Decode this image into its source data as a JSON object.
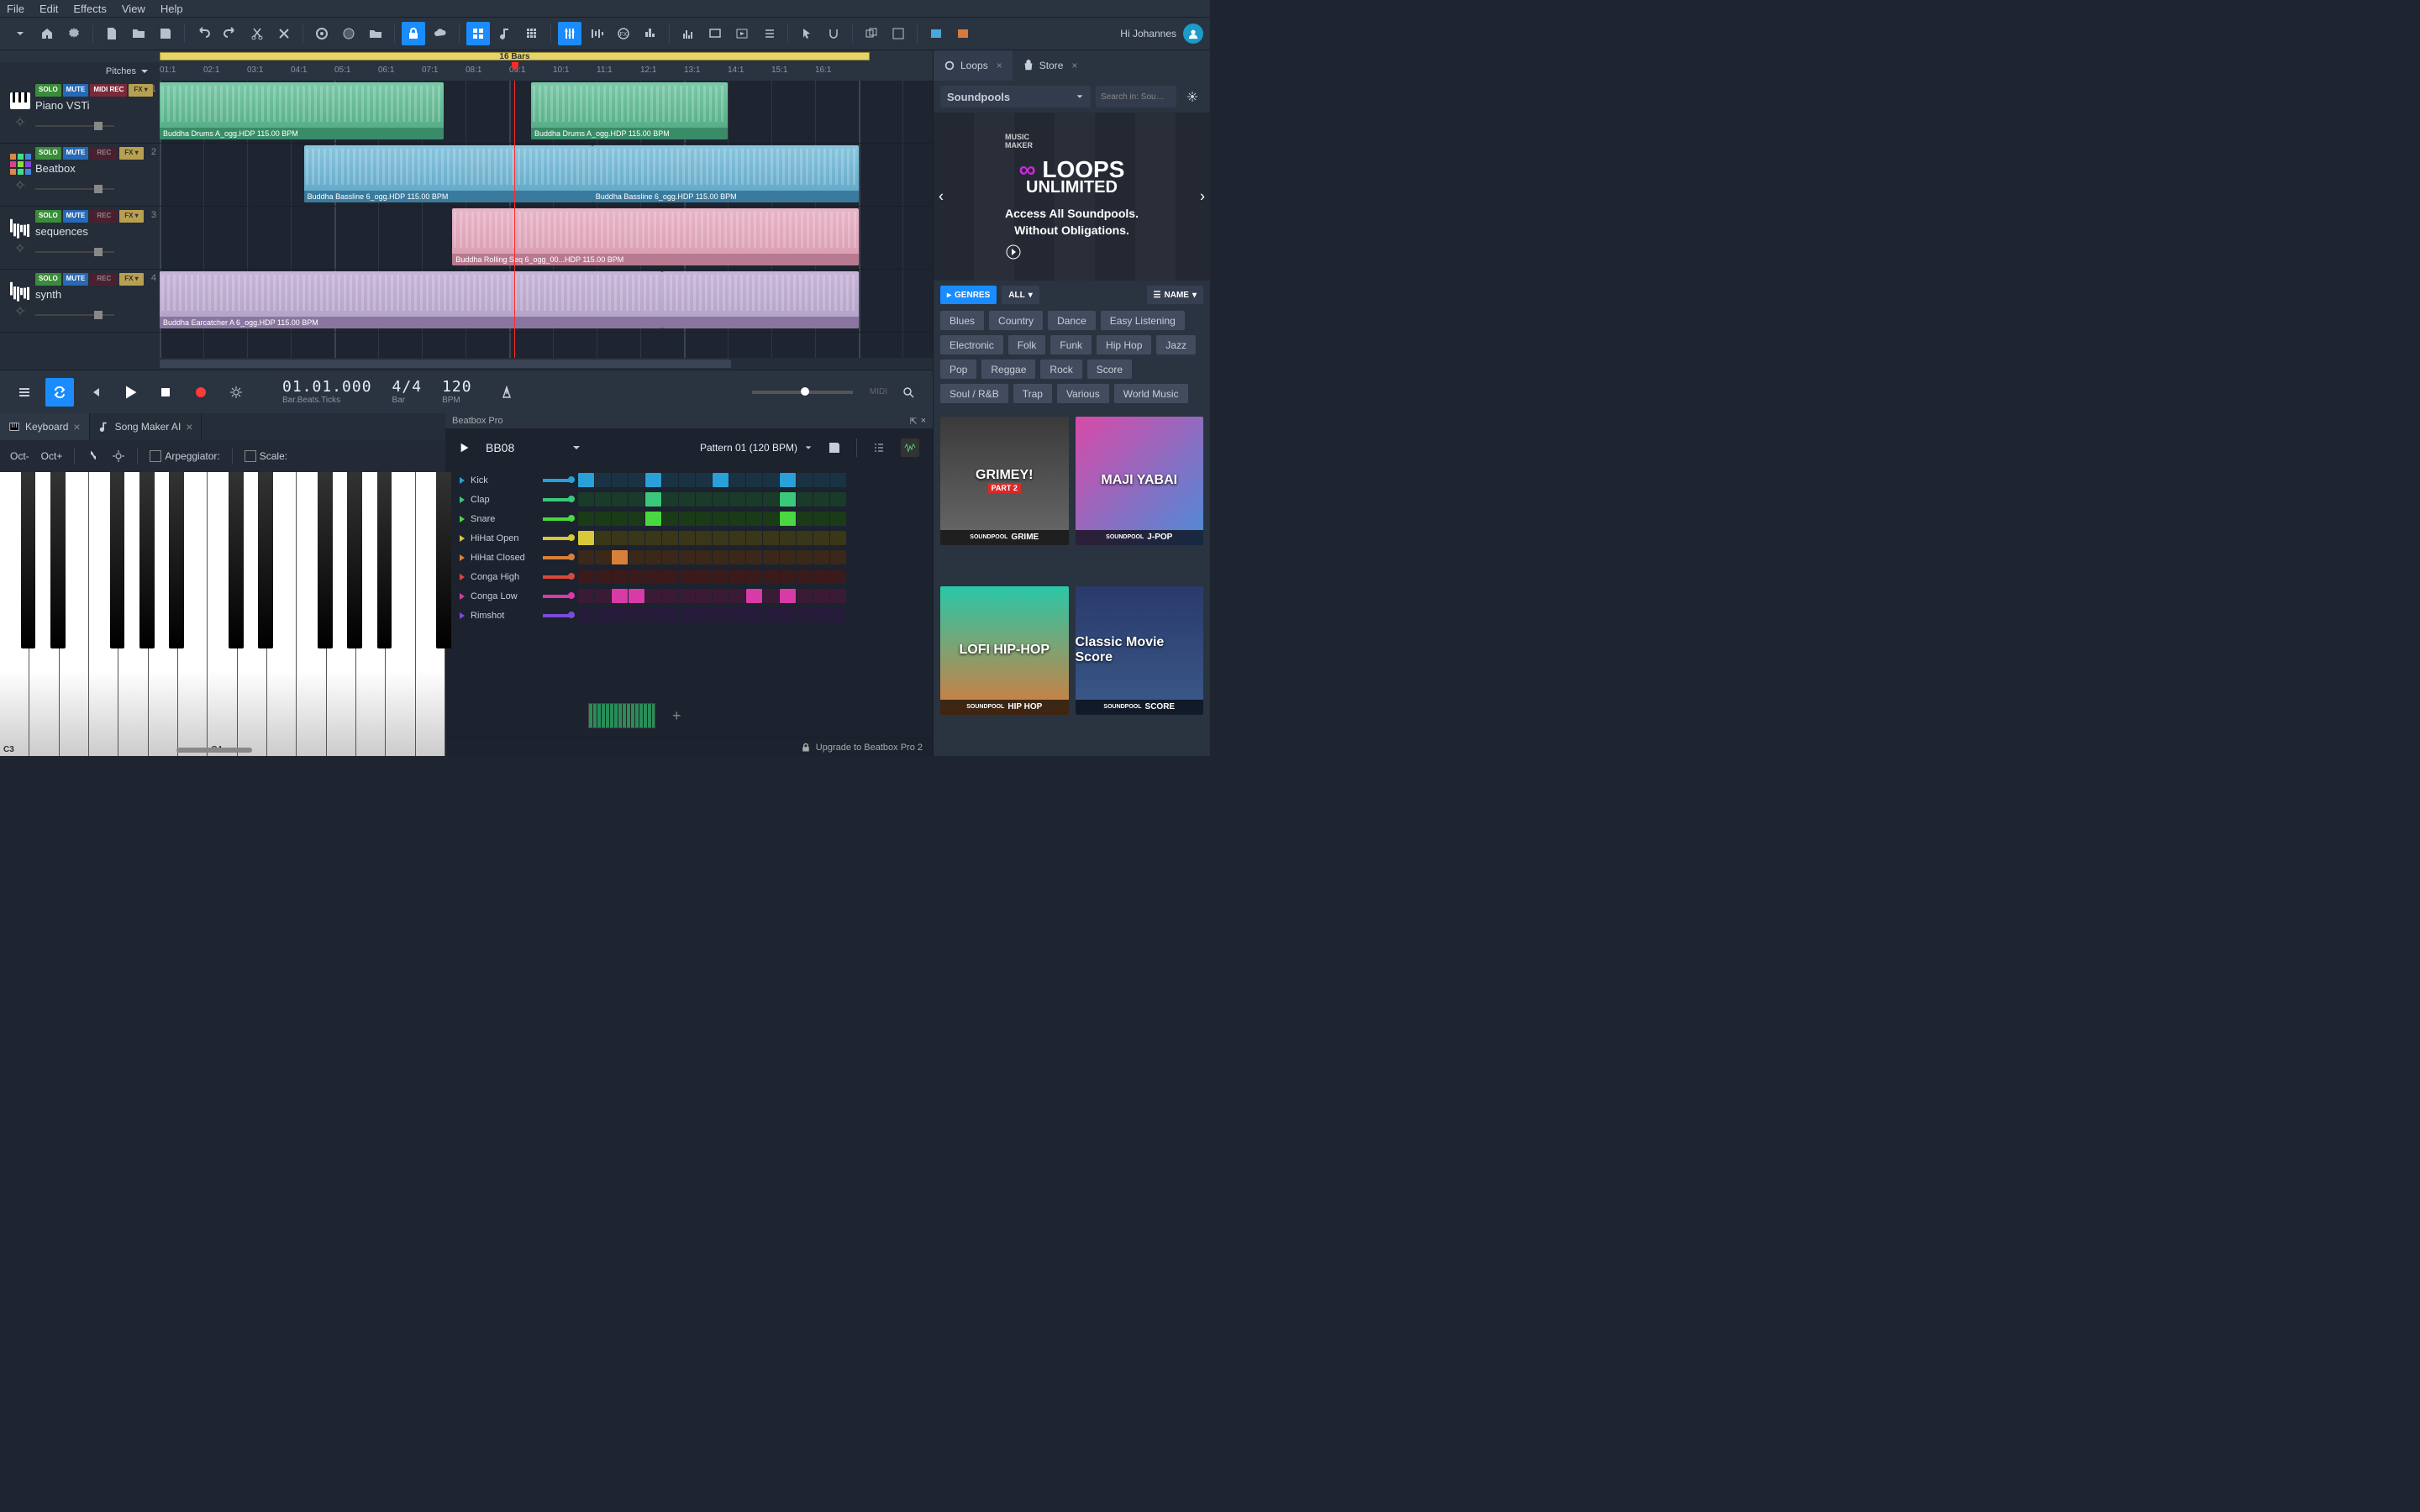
{
  "menubar": [
    "File",
    "Edit",
    "Effects",
    "View",
    "Help"
  ],
  "toolbar": {
    "greeting": "Hi Johannes"
  },
  "timeline": {
    "bars_label": "16 Bars",
    "pitches_label": "Pitches",
    "marks": [
      "01:1",
      "02:1",
      "03:1",
      "04:1",
      "05:1",
      "06:1",
      "07:1",
      "08:1",
      "09:1",
      "10:1",
      "11:1",
      "12:1",
      "13:1",
      "14:1",
      "15:1",
      "16:1"
    ],
    "playhead_index": 9
  },
  "tracks": [
    {
      "num": "1",
      "name": "Piano VSTi",
      "icon": "piano",
      "badges": [
        "SOLO",
        "MUTE",
        "MIDI REC",
        "FX ▾"
      ],
      "clips": [
        {
          "start": 0.5,
          "end": 7,
          "label": "Buddha Drums A_ogg.HDP  115.00 BPM",
          "color": "g"
        },
        {
          "start": 9,
          "end": 13.5,
          "label": "Buddha Drums A_ogg.HDP  115.00 BPM",
          "color": "g"
        }
      ]
    },
    {
      "num": "2",
      "name": "Beatbox",
      "icon": "grid",
      "badges": [
        "SOLO",
        "MUTE",
        "REC",
        "FX ▾"
      ],
      "clips": [
        {
          "start": 3.8,
          "end": 10.4,
          "label": "Buddha Bassline 6_ogg.HDP  115.00 BPM",
          "color": "b"
        },
        {
          "start": 10.4,
          "end": 16.5,
          "label": "Buddha Bassline 6_ogg.HDP  115.00 BPM",
          "color": "b"
        }
      ]
    },
    {
      "num": "3",
      "name": "sequences",
      "icon": "bars",
      "badges": [
        "SOLO",
        "MUTE",
        "REC",
        "FX ▾"
      ],
      "clips": [
        {
          "start": 7.2,
          "end": 16.5,
          "label": "Buddha Rolling Seq 6_ogg_00...HDP  115.00 BPM",
          "color": "p"
        }
      ]
    },
    {
      "num": "4",
      "name": "synth",
      "icon": "bars",
      "badges": [
        "SOLO",
        "MUTE",
        "REC",
        "FX ▾"
      ],
      "clips": [
        {
          "start": 0.5,
          "end": 12,
          "label": "Buddha Earcatcher A 6_ogg.HDP  115.00 BPM",
          "color": "v"
        },
        {
          "start": 12,
          "end": 16.5,
          "label": "",
          "color": "v"
        }
      ]
    }
  ],
  "transport": {
    "position": "01.01.000",
    "position_lbl": "Bar.Beats.Ticks",
    "sig": "4/4",
    "sig_lbl": "Bar",
    "bpm": "120",
    "bpm_lbl": "BPM",
    "midi_lbl": "MIDI"
  },
  "tabs": {
    "keyboard": "Keyboard",
    "songmaker": "Song Maker AI"
  },
  "keyboard_ctrl": {
    "oct_down": "Oct-",
    "oct_up": "Oct+",
    "arp": "Arpeggiator:",
    "scale": "Scale:",
    "labels": [
      "C3",
      "C4"
    ]
  },
  "beatbox": {
    "title": "Beatbox Pro",
    "kit": "BB08",
    "pattern": "Pattern 01 (120 BPM)",
    "rows": [
      {
        "name": "Kick",
        "cls": "kick",
        "color": "#2aa0d8",
        "steps": [
          1,
          0,
          0,
          0,
          1,
          0,
          0,
          0,
          1,
          0,
          0,
          0,
          1,
          0,
          0,
          0
        ]
      },
      {
        "name": "Clap",
        "cls": "clap",
        "color": "#3ac87a",
        "steps": [
          0,
          0,
          0,
          0,
          1,
          0,
          0,
          0,
          0,
          0,
          0,
          0,
          1,
          0,
          0,
          0
        ]
      },
      {
        "name": "Snare",
        "cls": "snare",
        "color": "#4ad840",
        "steps": [
          0,
          0,
          0,
          0,
          1,
          0,
          0,
          0,
          0,
          0,
          0,
          0,
          1,
          0,
          0,
          0
        ]
      },
      {
        "name": "HiHat Open",
        "cls": "hho",
        "color": "#d8c83a",
        "steps": [
          1,
          0,
          0,
          0,
          0,
          0,
          0,
          0,
          0,
          0,
          0,
          0,
          0,
          0,
          0,
          0
        ]
      },
      {
        "name": "HiHat Closed",
        "cls": "hhc",
        "color": "#d8803a",
        "steps": [
          0,
          0,
          1,
          0,
          0,
          0,
          0,
          0,
          0,
          0,
          0,
          0,
          0,
          0,
          0,
          0
        ]
      },
      {
        "name": "Conga High",
        "cls": "ch",
        "color": "#d8483a",
        "steps": [
          0,
          0,
          0,
          0,
          0,
          0,
          0,
          0,
          0,
          0,
          0,
          0,
          0,
          0,
          0,
          0
        ]
      },
      {
        "name": "Conga Low",
        "cls": "cl",
        "color": "#d83aa8",
        "steps": [
          0,
          0,
          1,
          1,
          0,
          0,
          0,
          0,
          0,
          0,
          1,
          0,
          1,
          0,
          0,
          0
        ]
      },
      {
        "name": "Rimshot",
        "cls": "rim",
        "color": "#7a4ad8",
        "steps": [
          0,
          0,
          0,
          0,
          0,
          0,
          0,
          0,
          0,
          0,
          0,
          0,
          0,
          0,
          0,
          0
        ]
      }
    ],
    "upgrade": "Upgrade to Beatbox Pro 2"
  },
  "right": {
    "tabs": {
      "loops": "Loops",
      "store": "Store"
    },
    "category": "Soundpools",
    "search_placeholder": "Search in: Sou…",
    "promo": {
      "brand1": "LOOPS",
      "brand2": "UNLIMITED",
      "line1": "Access All Soundpools.",
      "line2": "Without Obligations."
    },
    "filter_genres_lbl": "GENRES",
    "filter_all": "ALL",
    "filter_name": "NAME",
    "genres": [
      "Blues",
      "Country",
      "Dance",
      "Easy Listening",
      "Electronic",
      "Folk",
      "Funk",
      "Hip Hop",
      "Jazz",
      "Pop",
      "Reggae",
      "Rock",
      "Score",
      "Soul / R&B",
      "Trap",
      "Various",
      "World Music"
    ],
    "packs": [
      {
        "title": "GRIMEY!",
        "sub": "PART 2",
        "foot": "GRIME",
        "bg": "linear-gradient(#3a3a3a,#6a6a6a)"
      },
      {
        "title": "MAJI YABAI",
        "sub": "",
        "foot": "J-POP",
        "bg": "linear-gradient(135deg,#d84aa8,#4a8cd8)"
      },
      {
        "title": "LOFI HIP-HOP",
        "sub": "",
        "foot": "HIP HOP",
        "bg": "linear-gradient(#2ac8a8,#d87a3a)"
      },
      {
        "title": "Classic Movie Score",
        "sub": "",
        "foot": "SCORE",
        "bg": "linear-gradient(#2a3a6a,#3a5a8a)"
      }
    ]
  }
}
